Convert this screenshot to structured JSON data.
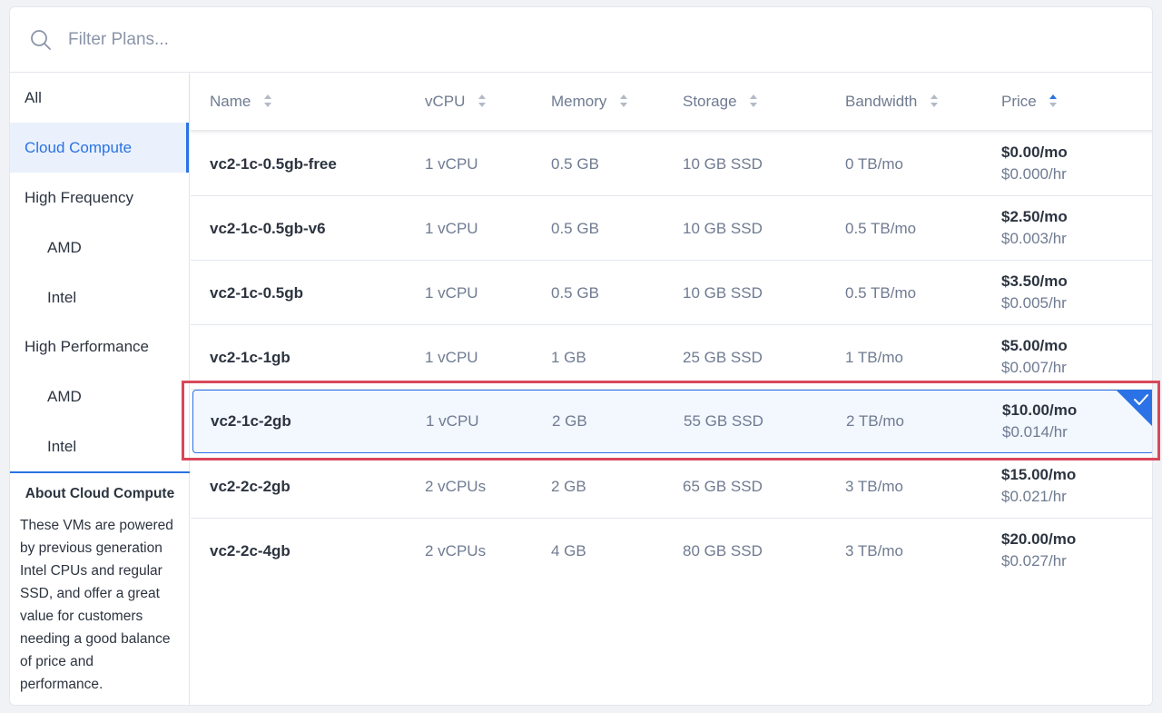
{
  "search": {
    "placeholder": "Filter Plans..."
  },
  "sidebar": {
    "items": [
      {
        "label": "All"
      },
      {
        "label": "Cloud Compute",
        "active": true
      },
      {
        "label": "High Frequency"
      },
      {
        "label": "AMD"
      },
      {
        "label": "Intel"
      },
      {
        "label": "High Performance"
      },
      {
        "label": "AMD"
      },
      {
        "label": "Intel"
      }
    ],
    "about": {
      "title": "About Cloud Compute",
      "text": "These VMs are powered by previous generation Intel CPUs and regular SSD, and offer a great value for customers needing a good balance of price and performance."
    }
  },
  "table": {
    "columns": [
      "Name",
      "vCPU",
      "Memory",
      "Storage",
      "Bandwidth",
      "Price"
    ],
    "sorted_by": "Price",
    "sort_direction": "ascending",
    "rows": [
      {
        "name": "vc2-1c-0.5gb-free",
        "vcpu": "1 vCPU",
        "memory": "0.5 GB",
        "storage": "10 GB SSD",
        "bandwidth": "0 TB/mo",
        "price_mo": "$0.00/mo",
        "price_hr": "$0.000/hr"
      },
      {
        "name": "vc2-1c-0.5gb-v6",
        "vcpu": "1 vCPU",
        "memory": "0.5 GB",
        "storage": "10 GB SSD",
        "bandwidth": "0.5 TB/mo",
        "price_mo": "$2.50/mo",
        "price_hr": "$0.003/hr"
      },
      {
        "name": "vc2-1c-0.5gb",
        "vcpu": "1 vCPU",
        "memory": "0.5 GB",
        "storage": "10 GB SSD",
        "bandwidth": "0.5 TB/mo",
        "price_mo": "$3.50/mo",
        "price_hr": "$0.005/hr"
      },
      {
        "name": "vc2-1c-1gb",
        "vcpu": "1 vCPU",
        "memory": "1 GB",
        "storage": "25 GB SSD",
        "bandwidth": "1 TB/mo",
        "price_mo": "$5.00/mo",
        "price_hr": "$0.007/hr"
      },
      {
        "name": "vc2-1c-2gb",
        "vcpu": "1 vCPU",
        "memory": "2 GB",
        "storage": "55 GB SSD",
        "bandwidth": "2 TB/mo",
        "price_mo": "$10.00/mo",
        "price_hr": "$0.014/hr",
        "selected": true
      },
      {
        "name": "vc2-2c-2gb",
        "vcpu": "2 vCPUs",
        "memory": "2 GB",
        "storage": "65 GB SSD",
        "bandwidth": "3 TB/mo",
        "price_mo": "$15.00/mo",
        "price_hr": "$0.021/hr"
      },
      {
        "name": "vc2-2c-4gb",
        "vcpu": "2 vCPUs",
        "memory": "4 GB",
        "storage": "80 GB SSD",
        "bandwidth": "3 TB/mo",
        "price_mo": "$20.00/mo",
        "price_hr": "$0.027/hr"
      }
    ]
  },
  "colors": {
    "accent": "#2a72e5",
    "highlight_box": "#d9475b",
    "text_primary": "#2c3440",
    "text_secondary": "#6f7b91"
  },
  "icons": {
    "search": "search-icon",
    "sort": "sort-icon",
    "sort_asc": "sort-ascending-icon",
    "selected": "checkmark-icon"
  }
}
